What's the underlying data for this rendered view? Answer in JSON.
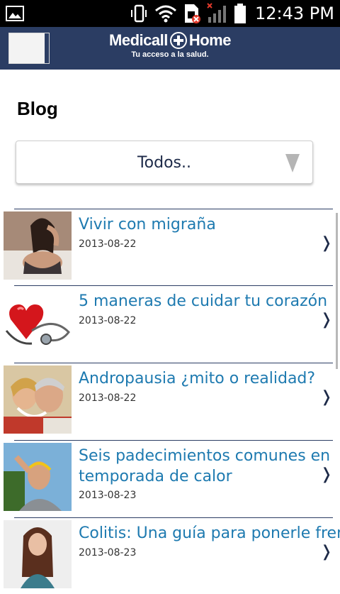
{
  "status_bar": {
    "time": "12:43 PM",
    "icons": [
      "image-icon",
      "vibrate-icon",
      "wifi-icon",
      "sim-error-icon",
      "signal-icon",
      "battery-icon"
    ]
  },
  "header": {
    "logo_main_left": "Medicall",
    "logo_main_right": "Home",
    "logo_tagline": "Tu acceso a la salud.",
    "brand_color": "#2b3d63"
  },
  "page": {
    "title": "Blog"
  },
  "filter": {
    "selected": "Todos.."
  },
  "posts": [
    {
      "title": "Vivir con migraña",
      "date": "2013-08-22",
      "thumb": "woman-headache-photo"
    },
    {
      "title": "5 maneras de cuidar tu corazón",
      "date": "2013-08-22",
      "thumb": "heart-stethoscope-photo"
    },
    {
      "title": "Andropausia ¿mito o realidad?",
      "date": "2013-08-22",
      "thumb": "couple-smiling-photo"
    },
    {
      "title": "Seis padecimientos comunes en temporada de calor",
      "date": "2013-08-23",
      "thumb": "man-sun-heat-photo"
    },
    {
      "title": "Colitis: Una guía para ponerle fren",
      "date": "2013-08-23",
      "thumb": "woman-sad-photo"
    }
  ],
  "accent_color": "#1e7ab0"
}
